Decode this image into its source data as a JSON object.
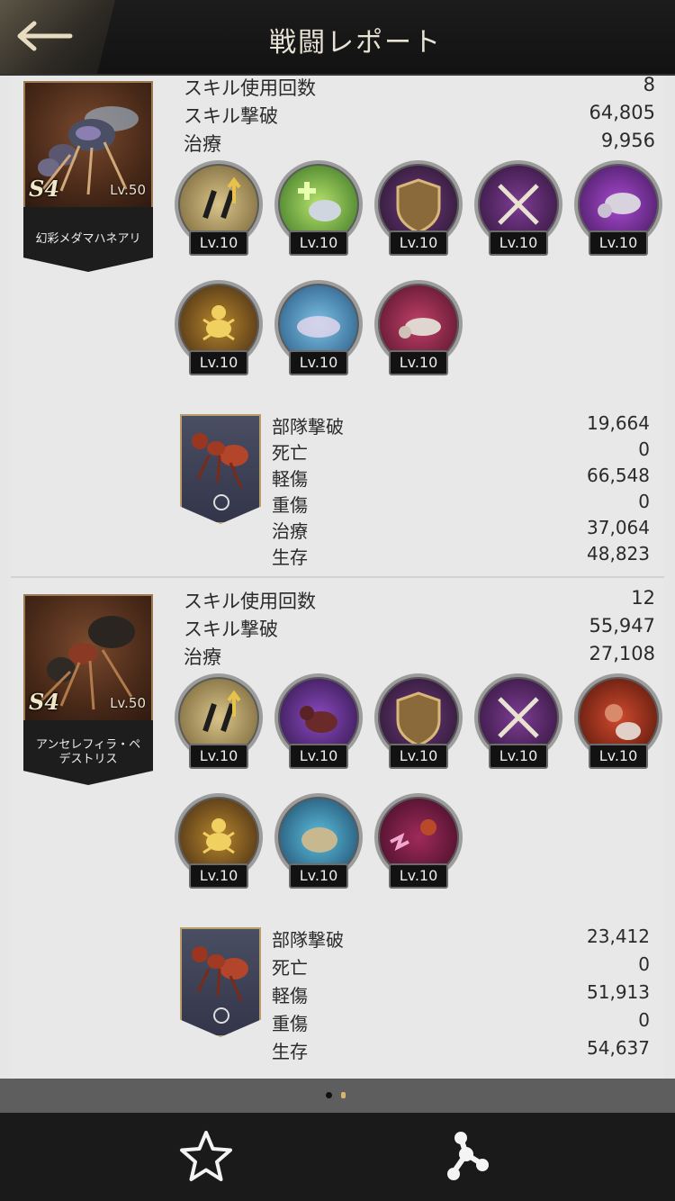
{
  "header": {
    "title": "戦闘レポート",
    "back": "back-arrow-icon"
  },
  "heroes": [
    {
      "name": "幻彩メダマハネアリ",
      "tier": "S4",
      "level": "Lv.50",
      "stats": [
        {
          "label": "スキル使用回数",
          "value": "8"
        },
        {
          "label": "スキル撃破",
          "value": "64,805"
        },
        {
          "label": "治療",
          "value": "9,956"
        }
      ],
      "skills": [
        "Lv.10",
        "Lv.10",
        "Lv.10",
        "Lv.10",
        "Lv.10",
        "Lv.10",
        "Lv.10",
        "Lv.10"
      ],
      "troop": [
        {
          "label": "部隊撃破",
          "value": "19,664"
        },
        {
          "label": "死亡",
          "value": "0"
        },
        {
          "label": "軽傷",
          "value": "66,548"
        },
        {
          "label": "重傷",
          "value": "0"
        },
        {
          "label": "治療",
          "value": "37,064"
        },
        {
          "label": "生存",
          "value": "48,823"
        }
      ]
    },
    {
      "name": "アンセレフィラ・ペデストリス",
      "tier": "S4",
      "level": "Lv.50",
      "stats": [
        {
          "label": "スキル使用回数",
          "value": "12"
        },
        {
          "label": "スキル撃破",
          "value": "55,947"
        },
        {
          "label": "治療",
          "value": "27,108"
        }
      ],
      "skills": [
        "Lv.10",
        "Lv.10",
        "Lv.10",
        "Lv.10",
        "Lv.10",
        "Lv.10",
        "Lv.10",
        "Lv.10"
      ],
      "troop": [
        {
          "label": "部隊撃破",
          "value": "23,412"
        },
        {
          "label": "死亡",
          "value": "0"
        },
        {
          "label": "軽傷",
          "value": "51,913"
        },
        {
          "label": "重傷",
          "value": "0"
        },
        {
          "label": "生存",
          "value": "54,637"
        }
      ]
    }
  ],
  "pager": {
    "pages": 2,
    "current": 1
  },
  "bottom": {
    "favorite": "star-icon",
    "share": "share-icon"
  }
}
